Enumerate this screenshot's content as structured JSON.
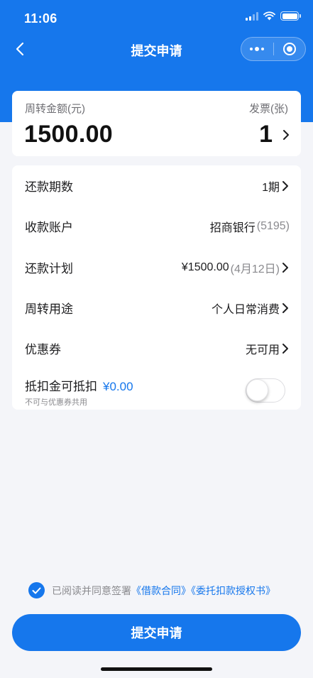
{
  "status_bar": {
    "time": "11:06"
  },
  "nav": {
    "title": "提交申请"
  },
  "amount_card": {
    "amount_label": "周转金额(元)",
    "amount_value": "1500.00",
    "invoice_label": "发票(张)",
    "invoice_value": "1"
  },
  "details": {
    "rows": [
      {
        "label": "还款期数",
        "value": "1期",
        "suffix": ""
      },
      {
        "label": "收款账户",
        "value": "招商银行",
        "suffix": "(5195)"
      },
      {
        "label": "还款计划",
        "value": "¥1500.00",
        "suffix": "(4月12日)"
      },
      {
        "label": "周转用途",
        "value": "个人日常消费",
        "suffix": ""
      },
      {
        "label": "优惠券",
        "value": "无可用",
        "suffix": ""
      }
    ],
    "deduction": {
      "label": "抵扣金可抵扣",
      "amount": "¥0.00",
      "note": "不可与优惠券共用",
      "enabled": false
    }
  },
  "agreement": {
    "text": "已阅读并同意签署",
    "link1": "《借款合同》",
    "link2": "《委托扣款授权书》",
    "checked": true
  },
  "submit_label": "提交申请",
  "colors": {
    "brand_blue": "#1677ec",
    "page_bg": "#f4f5f9"
  }
}
